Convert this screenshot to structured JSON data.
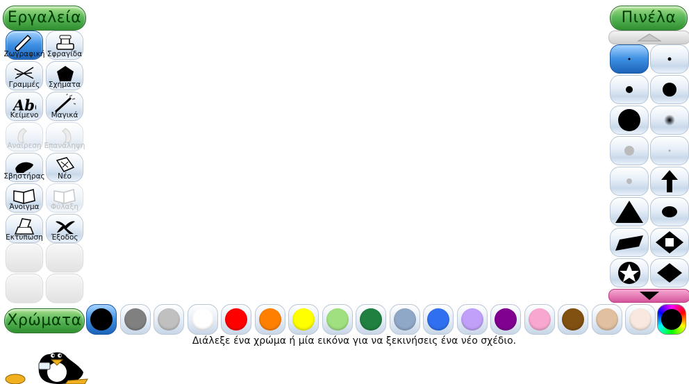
{
  "headers": {
    "tools": "Εργαλεία",
    "brushes": "Πινέλα",
    "colors": "Χρώματα"
  },
  "tools": [
    {
      "id": "paint",
      "label": "Ζωγραφική",
      "icon": "paintbrush-icon",
      "selected": true,
      "enabled": true
    },
    {
      "id": "stamp",
      "label": "Σφραγίδα",
      "icon": "stamp-icon",
      "selected": false,
      "enabled": true
    },
    {
      "id": "lines",
      "label": "Γραμμές",
      "icon": "lines-icon",
      "selected": false,
      "enabled": true
    },
    {
      "id": "shapes",
      "label": "Σχήματα",
      "icon": "pentagon-icon",
      "selected": false,
      "enabled": true
    },
    {
      "id": "text",
      "label": "Κείμενο",
      "icon": "text-abc-icon",
      "selected": false,
      "enabled": true
    },
    {
      "id": "magic",
      "label": "Μαγικά",
      "icon": "magic-wand-icon",
      "selected": false,
      "enabled": true
    },
    {
      "id": "undo",
      "label": "Αναίρεση",
      "icon": "undo-icon",
      "selected": false,
      "enabled": false
    },
    {
      "id": "redo",
      "label": "Επανάληψη",
      "icon": "redo-icon",
      "selected": false,
      "enabled": false
    },
    {
      "id": "eraser",
      "label": "Σβηστήρας",
      "icon": "eraser-icon",
      "selected": false,
      "enabled": true
    },
    {
      "id": "new",
      "label": "Νέο",
      "icon": "new-page-icon",
      "selected": false,
      "enabled": true
    },
    {
      "id": "open",
      "label": "Άνοιγμα",
      "icon": "open-book-icon",
      "selected": false,
      "enabled": true
    },
    {
      "id": "save",
      "label": "Φύλαξη",
      "icon": "save-book-icon",
      "selected": false,
      "enabled": false
    },
    {
      "id": "print",
      "label": "Εκτύπωση",
      "icon": "printer-icon",
      "selected": false,
      "enabled": true
    },
    {
      "id": "quit",
      "label": "Έξοδος",
      "icon": "quit-x-icon",
      "selected": false,
      "enabled": true
    }
  ],
  "brushes": [
    {
      "shape": "tiny-dot",
      "selected": true
    },
    {
      "shape": "small-dot",
      "selected": false
    },
    {
      "shape": "medium-dot",
      "selected": false
    },
    {
      "shape": "large-dot",
      "selected": false
    },
    {
      "shape": "huge-dot",
      "selected": false
    },
    {
      "shape": "fuzzy-dot",
      "selected": false
    },
    {
      "shape": "gray-soft",
      "selected": false
    },
    {
      "shape": "gray-tiny",
      "selected": false
    },
    {
      "shape": "gray-small",
      "selected": false
    },
    {
      "shape": "arrow-up",
      "selected": false
    },
    {
      "shape": "triangle",
      "selected": false
    },
    {
      "shape": "oval",
      "selected": false
    },
    {
      "shape": "parallelogram",
      "selected": false
    },
    {
      "shape": "diamond-outline",
      "selected": false
    },
    {
      "shape": "star",
      "selected": false
    },
    {
      "shape": "diamond",
      "selected": false
    }
  ],
  "colors": [
    {
      "hex": "#000000",
      "selected": true
    },
    {
      "hex": "#808080",
      "selected": false
    },
    {
      "hex": "#c0c0c0",
      "selected": false
    },
    {
      "hex": "#ffffff",
      "selected": false
    },
    {
      "hex": "#ff0000",
      "selected": false
    },
    {
      "hex": "#ff8000",
      "selected": false
    },
    {
      "hex": "#ffff00",
      "selected": false
    },
    {
      "hex": "#a0e080",
      "selected": false
    },
    {
      "hex": "#208040",
      "selected": false
    },
    {
      "hex": "#90a8c8",
      "selected": false
    },
    {
      "hex": "#3070f0",
      "selected": false
    },
    {
      "hex": "#c0a0f8",
      "selected": false
    },
    {
      "hex": "#800090",
      "selected": false
    },
    {
      "hex": "#f8a8d0",
      "selected": false
    },
    {
      "hex": "#805010",
      "selected": false
    },
    {
      "hex": "#e0c0a0",
      "selected": false
    },
    {
      "hex": "#f8e8e0",
      "selected": false
    }
  ],
  "status_message": "Διάλεξε ένα χρώμα ή μία εικόνα για να ξεκινήσεις ένα νέο σχέδιο."
}
